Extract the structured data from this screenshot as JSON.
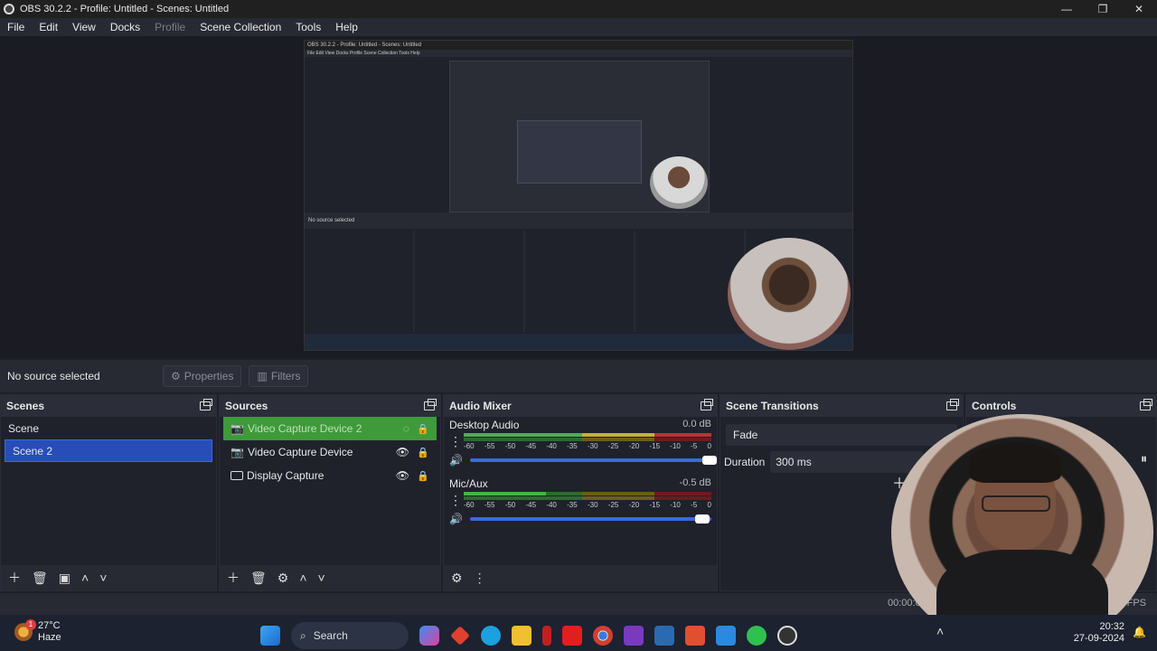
{
  "window": {
    "title": "OBS 30.2.2 - Profile: Untitled - Scenes: Untitled",
    "min": "—",
    "max": "❐",
    "close": "✕"
  },
  "menu": [
    "File",
    "Edit",
    "View",
    "Docks",
    "Profile",
    "Scene Collection",
    "Tools",
    "Help"
  ],
  "nested": {
    "title": "OBS 30.2.2 - Profile: Untitled - Scenes: Untitled",
    "menu": "File   Edit   View   Docks   Profile   Scene Collection   Tools   Help",
    "bar": "No source selected"
  },
  "source_bar": {
    "no_source": "No source selected",
    "properties": "Properties",
    "filters": "Filters"
  },
  "scenes": {
    "title": "Scenes",
    "items": [
      "Scene",
      "Scene 2"
    ],
    "selected": 1
  },
  "sources": {
    "title": "Sources",
    "items": [
      {
        "label": "Video Capture Device 2",
        "selected": true
      },
      {
        "label": "Video Capture Device",
        "selected": false
      },
      {
        "label": "Display Capture",
        "selected": false
      }
    ]
  },
  "mixer": {
    "title": "Audio Mixer",
    "channels": [
      {
        "name": "Desktop Audio",
        "db": "0.0 dB",
        "level": 0.81
      },
      {
        "name": "Mic/Aux",
        "db": "-0.5 dB",
        "level": 0.78
      }
    ],
    "scale": [
      "-60",
      "-55",
      "-50",
      "-45",
      "-40",
      "-35",
      "-30",
      "-25",
      "-20",
      "-15",
      "-10",
      "-5",
      "0"
    ]
  },
  "transitions": {
    "title": "Scene Transitions",
    "selected": "Fade",
    "duration_label": "Duration",
    "duration_value": "300 ms"
  },
  "controls": {
    "title": "Controls"
  },
  "status": {
    "time": "00:00:0",
    "fps": "0 FPS"
  },
  "taskbar": {
    "temp": "27°C",
    "weather": "Haze",
    "badge": "1",
    "search": "Search",
    "time": "20:32",
    "date": "27-09-2024"
  },
  "colors": {
    "accent": "#284cb8",
    "source_selected": "#3f9a3a",
    "panel": "#1f212b",
    "header": "#2b2e38"
  }
}
